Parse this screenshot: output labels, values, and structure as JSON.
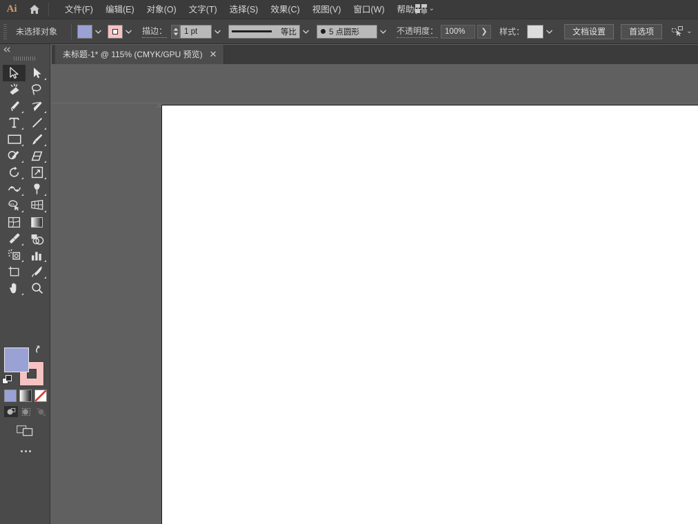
{
  "app": {
    "logo_text": "Ai",
    "home_icon": "home-icon",
    "workspace_icon": "workspace-layout-icon",
    "workspace_chevron": "⌄"
  },
  "menubar": {
    "items": [
      {
        "label": "文件(F)",
        "name": "menu-file"
      },
      {
        "label": "编辑(E)",
        "name": "menu-edit"
      },
      {
        "label": "对象(O)",
        "name": "menu-object"
      },
      {
        "label": "文字(T)",
        "name": "menu-type"
      },
      {
        "label": "选择(S)",
        "name": "menu-select"
      },
      {
        "label": "效果(C)",
        "name": "menu-effect"
      },
      {
        "label": "视图(V)",
        "name": "menu-view"
      },
      {
        "label": "窗口(W)",
        "name": "menu-window"
      },
      {
        "label": "帮助(H)",
        "name": "menu-help"
      }
    ]
  },
  "controlbar": {
    "selection_status": "未选择对象",
    "fill_color": "#9aa1d4",
    "stroke_color": "#f6c2c2",
    "stroke_label": "描边：",
    "stroke_weight": "1 pt",
    "profile_label": "等比",
    "brush_label": "5 点圆形",
    "opacity_label": "不透明度：",
    "opacity_value": "100%",
    "opacity_arrow": "❯",
    "style_label": "样式：",
    "style_swatch_color": "#dcdcdc",
    "doc_setup_button": "文档设置",
    "preferences_button": "首选项",
    "select_similar_icon": "select-similar-objects-icon",
    "chevron": "⌄"
  },
  "tabbar": {
    "document_tab": {
      "title": "未标题-1* @ 115% (CMYK/GPU 预览)",
      "close": "✕"
    }
  },
  "toolpanel": {
    "collapse_icon": "◀◀",
    "tools": [
      {
        "name": "selection-tool",
        "label": "选择工具",
        "active": true,
        "flyout": false
      },
      {
        "name": "direct-selection-tool",
        "label": "直接选择工具",
        "active": false,
        "flyout": true
      },
      {
        "name": "magic-wand-tool",
        "label": "魔棒工具",
        "active": false,
        "flyout": false
      },
      {
        "name": "lasso-tool",
        "label": "套索工具",
        "active": false,
        "flyout": false
      },
      {
        "name": "pen-tool",
        "label": "钢笔工具",
        "active": false,
        "flyout": true
      },
      {
        "name": "curvature-tool",
        "label": "曲率工具",
        "active": false,
        "flyout": true
      },
      {
        "name": "type-tool",
        "label": "文字工具",
        "active": false,
        "flyout": true
      },
      {
        "name": "line-segment-tool",
        "label": "直线段工具",
        "active": false,
        "flyout": true
      },
      {
        "name": "rectangle-tool",
        "label": "矩形工具",
        "active": false,
        "flyout": true
      },
      {
        "name": "paintbrush-tool",
        "label": "画笔工具",
        "active": false,
        "flyout": true
      },
      {
        "name": "shaper-pencil-tool",
        "label": "Shaper 工具",
        "active": false,
        "flyout": true
      },
      {
        "name": "eraser-tool",
        "label": "橡皮擦工具",
        "active": false,
        "flyout": true
      },
      {
        "name": "rotate-tool",
        "label": "旋转工具",
        "active": false,
        "flyout": true
      },
      {
        "name": "scale-tool",
        "label": "比例缩放工具",
        "active": false,
        "flyout": true
      },
      {
        "name": "width-warp-tool",
        "label": "宽度工具",
        "active": false,
        "flyout": true
      },
      {
        "name": "free-transform-tool",
        "label": "自由变换工具",
        "active": false,
        "flyout": true
      },
      {
        "name": "shape-builder-tool",
        "label": "形状生成器工具",
        "active": false,
        "flyout": true
      },
      {
        "name": "perspective-grid-tool",
        "label": "透视网格工具",
        "active": false,
        "flyout": true
      },
      {
        "name": "mesh-tool",
        "label": "网格工具",
        "active": false,
        "flyout": false
      },
      {
        "name": "gradient-tool",
        "label": "渐变工具",
        "active": false,
        "flyout": false
      },
      {
        "name": "eyedropper-tool",
        "label": "吸管工具",
        "active": false,
        "flyout": true
      },
      {
        "name": "blend-tool",
        "label": "混合工具",
        "active": false,
        "flyout": false
      },
      {
        "name": "symbol-sprayer-tool",
        "label": "符号喷枪工具",
        "active": false,
        "flyout": true
      },
      {
        "name": "column-graph-tool",
        "label": "柱形图工具",
        "active": false,
        "flyout": true
      },
      {
        "name": "artboard-tool",
        "label": "画板工具",
        "active": false,
        "flyout": false
      },
      {
        "name": "slice-tool",
        "label": "切片工具",
        "active": false,
        "flyout": true
      },
      {
        "name": "hand-tool",
        "label": "抓手工具",
        "active": false,
        "flyout": true
      },
      {
        "name": "zoom-tool",
        "label": "缩放工具",
        "active": false,
        "flyout": false
      }
    ],
    "fill_color": "#9aa1d4",
    "stroke_color": "#f6c2c2",
    "swap_icon": "swap-fill-stroke-icon",
    "default_icon": "default-fill-stroke-icon",
    "mode_buttons": [
      {
        "name": "color-mode-button",
        "label": "颜色"
      },
      {
        "name": "gradient-mode-button",
        "label": "渐变"
      },
      {
        "name": "none-mode-button",
        "label": "无"
      }
    ],
    "draw_buttons": [
      {
        "name": "draw-normal-button",
        "label": "正常绘图",
        "active": true
      },
      {
        "name": "draw-behind-button",
        "label": "背面绘图",
        "active": false
      },
      {
        "name": "draw-inside-button",
        "label": "内部绘图",
        "active": false
      }
    ],
    "screen_mode_icon": "change-screen-mode-icon",
    "more_tools_icon": "edit-toolbar-icon"
  },
  "canvas": {
    "background_color": "#606060",
    "artboard_color": "#ffffff",
    "zoom_level": "115%"
  }
}
